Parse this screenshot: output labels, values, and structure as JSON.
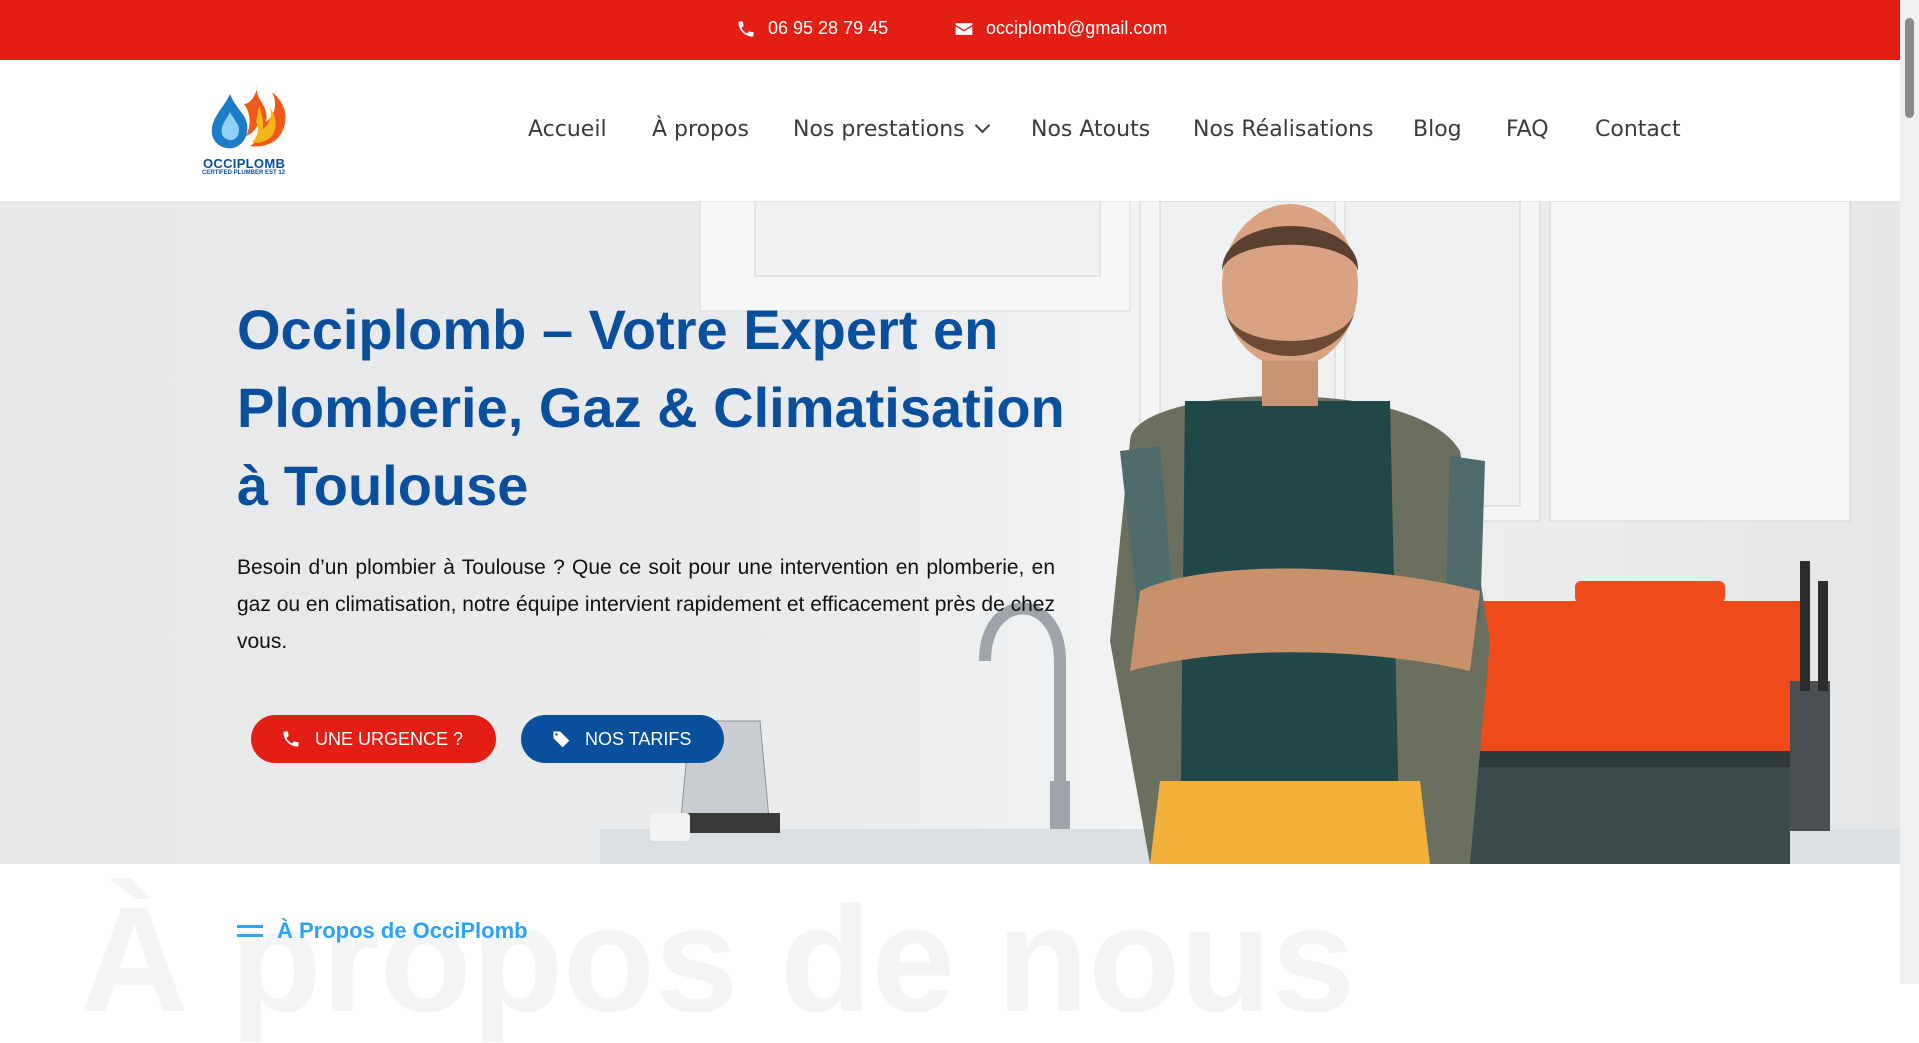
{
  "topbar": {
    "phone": "06 95 28 79 45",
    "email": "occiplomb@gmail.com",
    "phone_icon": "phone-icon",
    "email_icon": "envelope-icon",
    "background_color": "#e31e14"
  },
  "logo": {
    "brand": "OCCIPLOMB",
    "tagline": "CERTIFED PLUMBER EST 12"
  },
  "nav": {
    "items": [
      {
        "label": "Accueil"
      },
      {
        "label": "À propos"
      },
      {
        "label": "Nos prestations",
        "has_dropdown": true
      },
      {
        "label": "Nos Atouts"
      },
      {
        "label": "Nos Réalisations"
      },
      {
        "label": "Blog"
      },
      {
        "label": "FAQ"
      },
      {
        "label": "Contact"
      }
    ]
  },
  "hero": {
    "title": "Occiplomb – Votre Expert en Plomberie, Gaz & Climatisation à Toulouse",
    "text": "Besoin d’un plombier à Toulouse ? Que ce soit pour une intervention en plomberie, en gaz ou en climatisation, notre équipe intervient rapidement et efficacement près de chez vous.",
    "buttons": {
      "urgent": {
        "label": "UNE URGENCE ?",
        "icon": "phone-icon",
        "color": "#e31e14"
      },
      "tarifs": {
        "label": "NOS TARIFS",
        "icon": "tag-icon",
        "color": "#0a4f9c"
      }
    },
    "title_color": "#0a4f9c"
  },
  "about": {
    "heading": "À Propos de OcciPlomb",
    "background_text": "À propos de nous",
    "accent_color": "#2ea3f2"
  }
}
